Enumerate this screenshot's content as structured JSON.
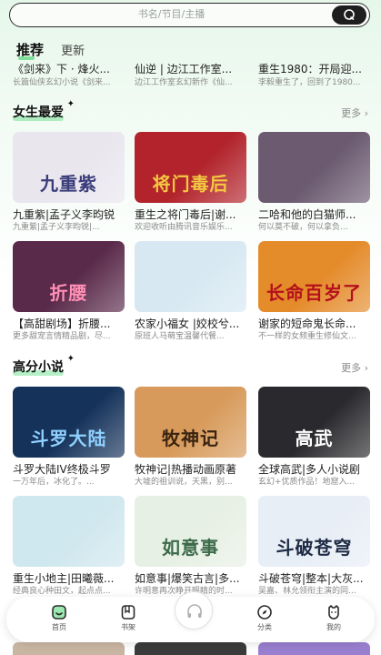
{
  "search": {
    "placeholder": "书名/节目/主播",
    "icon": "search-icon"
  },
  "tabs": {
    "active": "推荐",
    "other": "更新"
  },
  "recommend": [
    {
      "title": "《剑来》下 · 烽火...",
      "desc": "长篇仙侠玄幻小说《剑来..."
    },
    {
      "title": "仙逆 | 边江工作室...",
      "desc": "边江工作室玄幻新作《仙..."
    },
    {
      "title": "重生1980：开局迎...",
      "desc": "李毅重生了，回到了1980..."
    }
  ],
  "sections": [
    {
      "title": "女生最爱",
      "more": "更多",
      "items": [
        {
          "title": "九重紫|孟子义李昀锐",
          "desc": "九重紫|孟子义李昀锐|...",
          "cover_text": "九重紫",
          "bg": "#e9e6ee",
          "accent": "#3b3d7a"
        },
        {
          "title": "重生之将门毒后|谢...",
          "desc": "欢迎收听由腾讯音乐娱乐...",
          "cover_text": "将门毒后",
          "bg": "#b2232b",
          "accent": "#f4c842"
        },
        {
          "title": "二哈和他的白猫师...",
          "desc": "何以莫不破，何以拿负...",
          "cover_text": "",
          "bg": "#6b5a70",
          "accent": "#e9e2ea"
        },
        {
          "title": "【高甜剧场】折腰...",
          "desc": "更多甜宠言情精品剧，尽...",
          "cover_text": "折腰",
          "bg": "#5a2a4a",
          "accent": "#ff8fb5"
        },
        {
          "title": "农家小福女 |姣校兮...",
          "desc": "原班人马萌宝温馨代餐...",
          "cover_text": "",
          "bg": "#d7e8f2",
          "accent": "#2d3a5a"
        },
        {
          "title": "谢家的短命鬼长命...",
          "desc": "不一样的女频重生修仙文...",
          "cover_text": "长命百岁了",
          "bg": "#e48b2a",
          "accent": "#b4101c"
        }
      ]
    },
    {
      "title": "高分小说",
      "more": "更多",
      "items": [
        {
          "title": "斗罗大陆IV终极斗罗",
          "desc": "一万年后，冰化了。...",
          "cover_text": "斗罗大陆",
          "bg": "#15325a",
          "accent": "#8fd0ff"
        },
        {
          "title": "牧神记|热播动画原著",
          "desc": "大墟的祖训说，天黑，别...",
          "cover_text": "牧神记",
          "bg": "#d79a5a",
          "accent": "#3a2410"
        },
        {
          "title": "全球高武|多人小说剧",
          "desc": "玄幻+优质作品！地窟入...",
          "cover_text": "高武",
          "bg": "#2a2a2e",
          "accent": "#ffffff"
        },
        {
          "title": "重生小地主|田曦薇...",
          "desc": "经典良心种田文，起点点...",
          "cover_text": "",
          "bg": "#cfe7ee",
          "accent": "#2e5570"
        },
        {
          "title": "如意事|爆笑古言|多...",
          "desc": "许明意再次睁开眼睛的时...",
          "cover_text": "如意事",
          "bg": "#e7f0e4",
          "accent": "#3d6b4a"
        },
        {
          "title": "斗破苍穹|整本|大灰...",
          "desc": "吴嘉、林允领衔主演的同...",
          "cover_text": "斗破苍穹",
          "bg": "#e8eef6",
          "accent": "#1d2b44"
        }
      ]
    }
  ],
  "nav": [
    {
      "label": "首页",
      "icon": "home-icon",
      "active": true
    },
    {
      "label": "书架",
      "icon": "bookshelf-icon",
      "active": false
    },
    {
      "label": "",
      "icon": "headphones-icon",
      "active": false
    },
    {
      "label": "分类",
      "icon": "category-icon",
      "active": false
    },
    {
      "label": "我的",
      "icon": "profile-icon",
      "active": false
    }
  ],
  "colors": {
    "accent": "#3cc46a",
    "highlight": "#7fe09a"
  }
}
